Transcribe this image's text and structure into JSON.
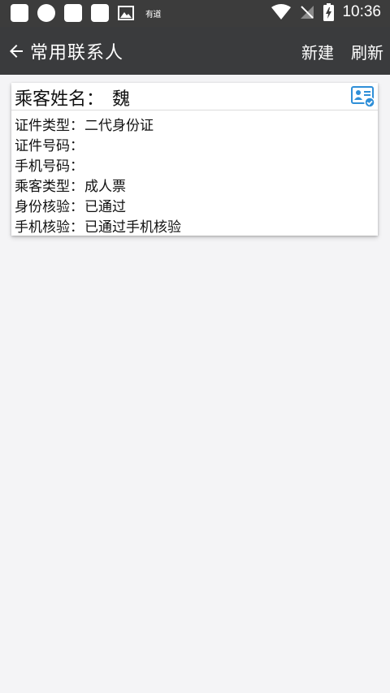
{
  "status_bar": {
    "app_name": "有道",
    "time": "10:36",
    "icons": [
      "app-icon",
      "circle-icon",
      "app-icon",
      "app-icon",
      "image-icon",
      "wifi-icon",
      "no-signal-icon",
      "battery-charging-icon"
    ]
  },
  "app_bar": {
    "title": "常用联系人",
    "new_label": "新建",
    "refresh_label": "刷新"
  },
  "contact": {
    "name_label": "乘客姓名：",
    "name_value": "魏",
    "rows": [
      {
        "label": "证件类型：",
        "value": "二代身份证"
      },
      {
        "label": "证件号码：",
        "value": ""
      },
      {
        "label": "手机号码：",
        "value": ""
      },
      {
        "label": "乘客类型：",
        "value": "成人票"
      },
      {
        "label": "身份核验：",
        "value": "已通过"
      },
      {
        "label": "手机核验：",
        "value": "已通过手机核验"
      }
    ]
  },
  "colors": {
    "app_bar": "#3a3b3d",
    "status_bar": "#3c3c3c",
    "background": "#f4f4f6",
    "id_icon_blue": "#2f8fd8"
  }
}
